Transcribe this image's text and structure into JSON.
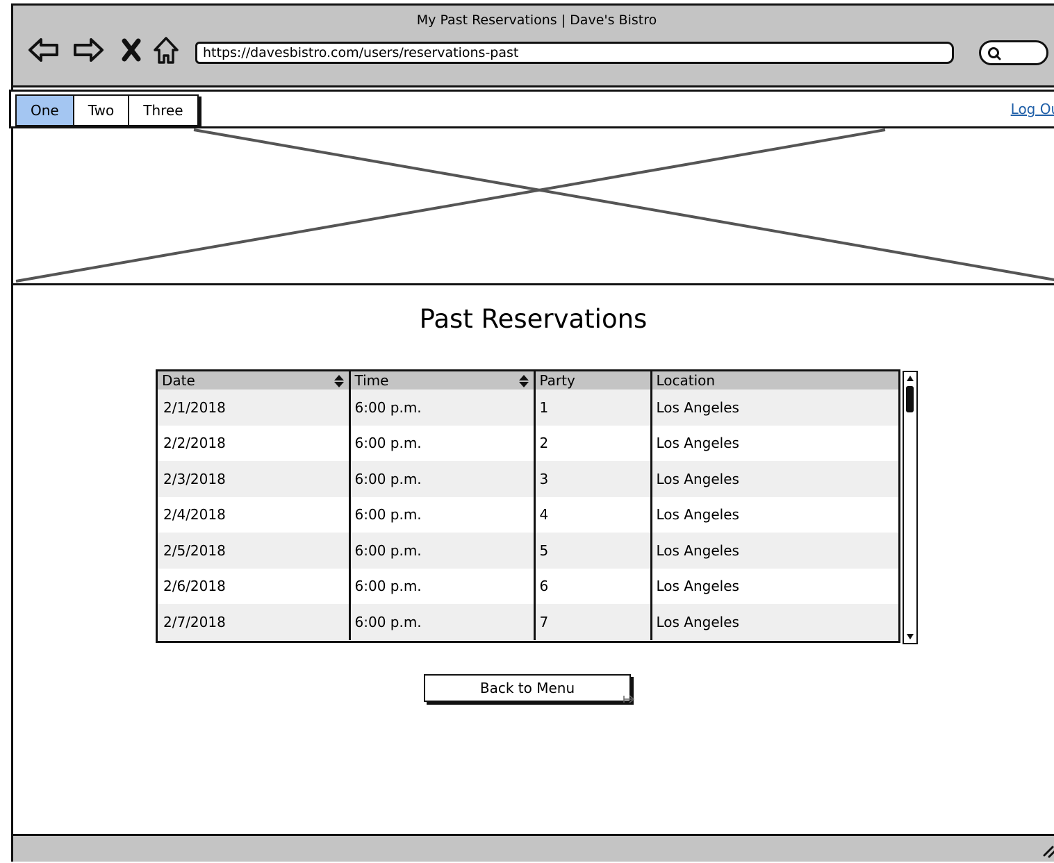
{
  "browser": {
    "window_title": "My Past Reservations | Dave's Bistro",
    "url": "https://davesbistro.com/users/reservations-past",
    "icons": [
      "back-arrow-icon",
      "forward-arrow-icon",
      "close-icon",
      "home-icon",
      "search-icon"
    ]
  },
  "nav": {
    "tabs": [
      {
        "label": "One",
        "active": true
      },
      {
        "label": "Two",
        "active": false
      },
      {
        "label": "Three",
        "active": false
      }
    ],
    "logout_label": "Log Out",
    "active_tab_color": "#a4c6f2",
    "link_color": "#1f5fa8"
  },
  "main": {
    "title": "Past Reservations",
    "table": {
      "columns": [
        "Date",
        "Time",
        "Party",
        "Location"
      ],
      "sortable": [
        true,
        true,
        false,
        false
      ],
      "rows": [
        [
          "2/1/2018",
          "6:00 p.m.",
          "1",
          "Los Angeles"
        ],
        [
          "2/2/2018",
          "6:00 p.m.",
          "2",
          "Los Angeles"
        ],
        [
          "2/3/2018",
          "6:00 p.m.",
          "3",
          "Los Angeles"
        ],
        [
          "2/4/2018",
          "6:00 p.m.",
          "4",
          "Los Angeles"
        ],
        [
          "2/5/2018",
          "6:00 p.m.",
          "5",
          "Los Angeles"
        ],
        [
          "2/6/2018",
          "6:00 p.m.",
          "6",
          "Los Angeles"
        ],
        [
          "2/7/2018",
          "6:00 p.m.",
          "7",
          "Los Angeles"
        ]
      ]
    },
    "back_button_label": "Back to Menu"
  }
}
